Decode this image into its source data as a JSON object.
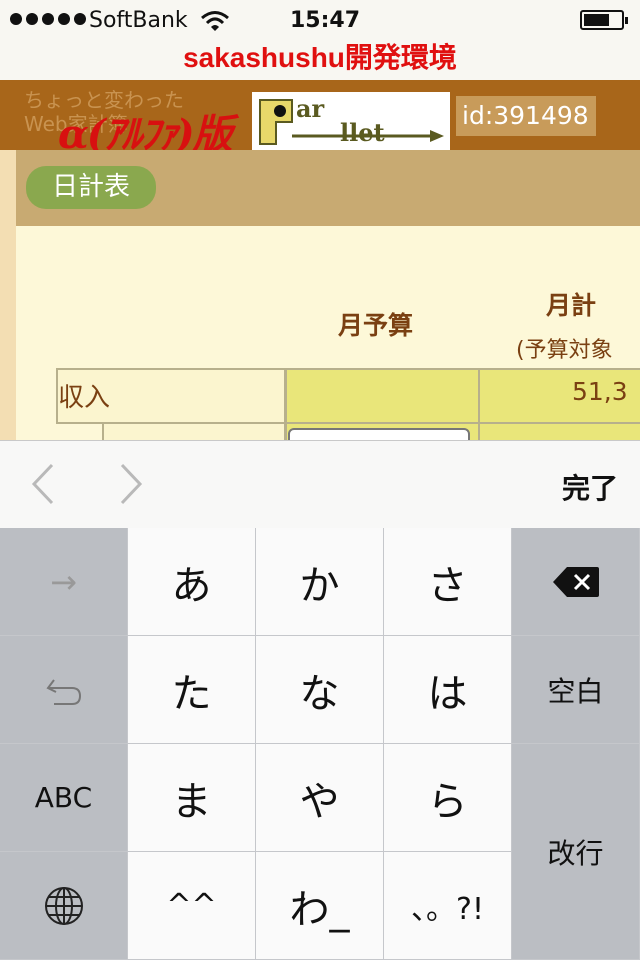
{
  "status_bar": {
    "carrier": "SoftBank",
    "time": "15:47",
    "battery_level": 0.7
  },
  "site_title": "sakashushu開発環境",
  "header": {
    "tagline_line1": "ちょっと変わった",
    "tagline_line2": "Web家計簿",
    "logo_text": "α(ｱﾙﾌｧ)版",
    "parllet_logo_text_1": "ar",
    "parllet_logo_text_2": "llet",
    "user_id": "id:391498"
  },
  "nav": {
    "daily_button": "日計表"
  },
  "table": {
    "col_budget": "月予算",
    "col_monthly": "月計",
    "col_monthly_sub": "(予算対象",
    "row_income_label": "収入",
    "row_income_value": "51,3"
  },
  "keyboard_toolbar": {
    "done_label": "完了",
    "prev_icon": "chevron-left-icon",
    "next_icon": "chevron-right-icon"
  },
  "keyboard": {
    "arrow_label": "→",
    "undo_label": "↶",
    "abc_label": "ABC",
    "globe_icon": "globe-icon",
    "backspace_icon": "backspace-icon",
    "row1": [
      "あ",
      "か",
      "さ"
    ],
    "row2": [
      "た",
      "な",
      "は"
    ],
    "row3": [
      "ま",
      "や",
      "ら"
    ],
    "row4": [
      "^^",
      "わ_",
      "、。?!"
    ],
    "space_label": "空白",
    "return_label": "改行"
  },
  "colors": {
    "title_red": "#e01010",
    "header_brown": "#a8661a",
    "button_green": "#8aa84e",
    "cell_yellow": "#e9e67a",
    "keyboard_dark": "#bbbec3"
  }
}
